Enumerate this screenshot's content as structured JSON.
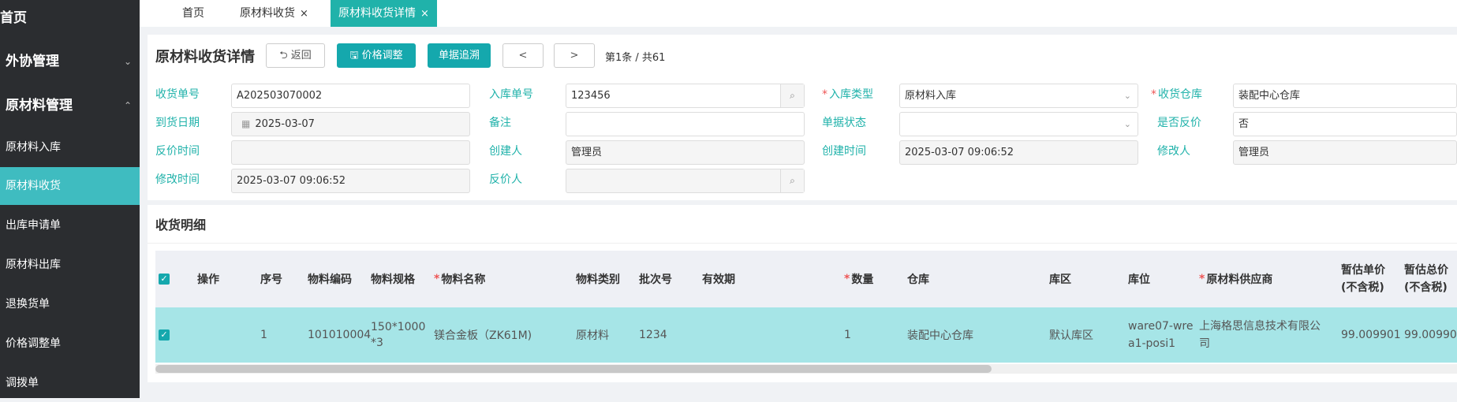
{
  "sidebar": {
    "top_items": [
      {
        "label": "首页",
        "arrow": ""
      },
      {
        "label": "外协管理",
        "arrow": "⌄"
      },
      {
        "label": "原材料管理",
        "arrow": "⌃"
      }
    ],
    "items": [
      {
        "label": "原材料入库"
      },
      {
        "label": "原材料收货"
      },
      {
        "label": "出库申请单"
      },
      {
        "label": "原材料出库"
      },
      {
        "label": "退换货单"
      },
      {
        "label": "价格调整单"
      },
      {
        "label": "调拨单"
      }
    ]
  },
  "tabs": [
    {
      "label": "首页",
      "close": ""
    },
    {
      "label": "原材料收货",
      "close": "×"
    },
    {
      "label": "原材料收货详情",
      "close": "×"
    }
  ],
  "header": {
    "title": "原材料收货详情",
    "back_label": "返回",
    "price_adjust_label": "价格调整",
    "trace_label": "单据追溯",
    "prev": "<",
    "next": ">",
    "pager": "第1条 / 共61"
  },
  "form": {
    "receipt_no_label": "收货单号",
    "receipt_no": "A202503070002",
    "inbound_no_label": "入库单号",
    "inbound_no": "123456",
    "inbound_type_label": "入库类型",
    "inbound_type": "原材料入库",
    "warehouse_label": "收货仓库",
    "warehouse": "装配中心仓库",
    "arrival_date_label": "到货日期",
    "arrival_date": "2025-03-07",
    "remark_label": "备注",
    "remark": "",
    "doc_status_label": "单据状态",
    "doc_status": "",
    "reverse_label": "是否反价",
    "reverse": "否",
    "reverse_time_label": "反价时间",
    "reverse_time": "",
    "creator_label": "创建人",
    "creator": "管理员",
    "create_time_label": "创建时间",
    "create_time": "2025-03-07 09:06:52",
    "modifier_label": "修改人",
    "modifier": "管理员",
    "modify_time_label": "修改时间",
    "modify_time": "2025-03-07 09:06:52",
    "reverser_label": "反价人",
    "reverser": ""
  },
  "detail": {
    "title": "收货明细",
    "columns": {
      "action": "操作",
      "seq": "序号",
      "code": "物料编码",
      "spec": "物料规格",
      "name": "物料名称",
      "category": "物料类别",
      "batch": "批次号",
      "expiry": "有效期",
      "qty": "数量",
      "warehouse": "仓库",
      "area": "库区",
      "location": "库位",
      "supplier": "原材料供应商",
      "unit_price": "暂估单价\n(不含税)",
      "total_price": "暂估总价\n(不含税)"
    },
    "row": {
      "seq": "1",
      "code": "101010004",
      "spec": "150*1000*3",
      "name": "镁合金板（ZK61M)",
      "category": "原材料",
      "batch": "1234",
      "expiry": "",
      "qty": "1",
      "warehouse": "装配中心仓库",
      "area": "默认库区",
      "location": "ware07-wrea1-posi1",
      "supplier": "上海格思信息技术有限公司",
      "unit_price": "99.009901",
      "total_price": "99.00990"
    }
  },
  "colors": {
    "accent": "#15a8ad",
    "sidebar_bg": "#2b2d30",
    "row_selected": "#a6e5e7"
  }
}
